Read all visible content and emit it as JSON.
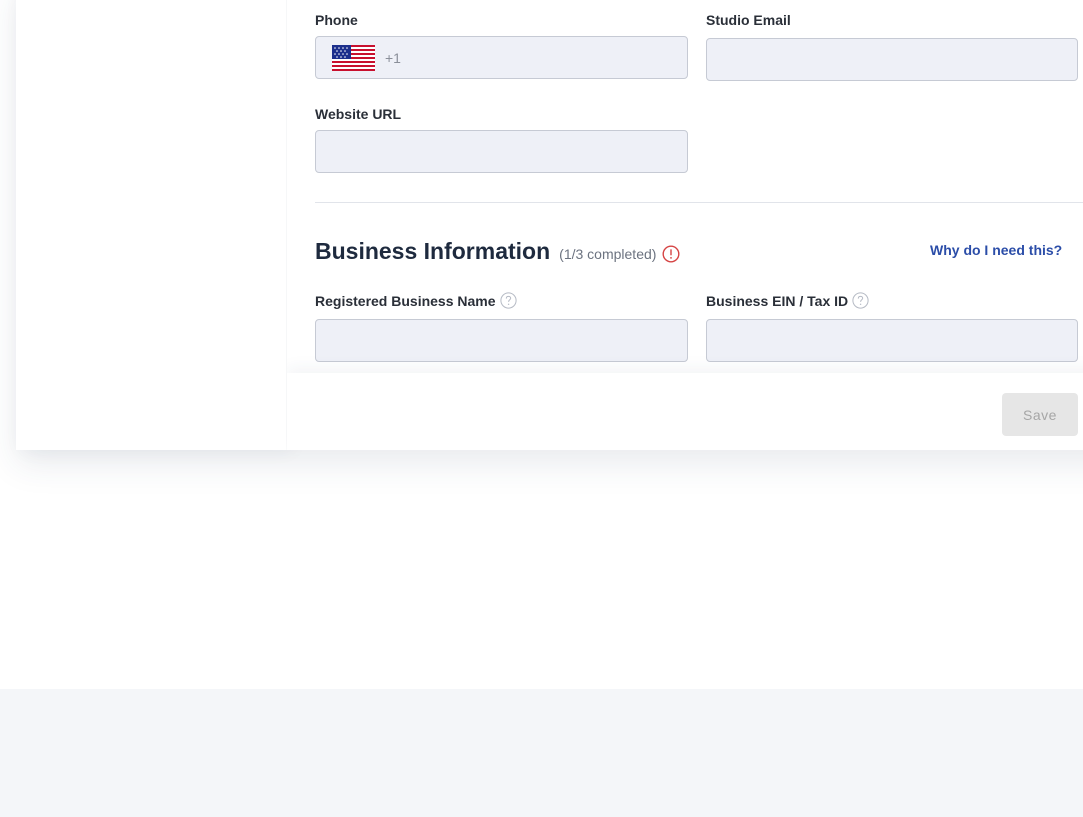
{
  "contact": {
    "phone_label": "Phone",
    "phone_country": "US",
    "phone_dial_code": "+1",
    "phone_value": "",
    "studio_email_label": "Studio Email",
    "studio_email_value": "",
    "website_url_label": "Website URL",
    "website_url_value": ""
  },
  "business": {
    "title": "Business Information",
    "progress": "(1/3 completed)",
    "alert_icon": "alert-circle-icon",
    "why_link": "Why do I need this?",
    "registered_name_label": "Registered Business Name",
    "registered_name_value": "",
    "ein_label": "Business EIN / Tax ID",
    "ein_value": "",
    "help_icon": "question-circle-icon"
  },
  "footer": {
    "save_label": "Save",
    "save_enabled": false
  },
  "colors": {
    "accent_link": "#2b4da8",
    "alert": "#d64545",
    "field_background": "#eef0f7",
    "field_border": "#c6cad4",
    "save_disabled_bg": "#e6e6e6",
    "save_disabled_text": "#a6a6a6"
  }
}
